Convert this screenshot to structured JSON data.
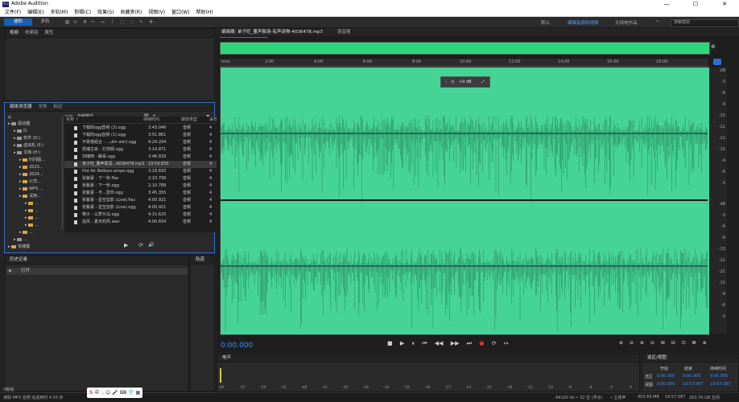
{
  "window": {
    "app_title": "Adobe Audition",
    "logo_text": "Au",
    "minimize": "—",
    "maximize": "☐",
    "close": "✕"
  },
  "menu": [
    "文件(F)",
    "编辑(E)",
    "多轨(M)",
    "剪辑(C)",
    "效果(S)",
    "收藏夹(R)",
    "视图(V)",
    "窗口(W)",
    "帮助(H)"
  ],
  "toolbar": {
    "waveform_label": "波形",
    "multitrack_label": "多轨",
    "workspace_default": "默认",
    "workspace_active": "编辑音频到视频",
    "workspace_radio": "无线电作品",
    "search_placeholder": "搜索帮助"
  },
  "files_panel": {
    "tabs": [
      "视频",
      "效果组",
      "属性"
    ]
  },
  "media_browser": {
    "tabs": [
      "媒体浏览器",
      "文件",
      "标记"
    ],
    "content_label": "内容:",
    "content_value": "音频模式",
    "tree": [
      {
        "label": "驱动器",
        "kind": "drive",
        "indent": 0
      },
      {
        "label": "D:",
        "kind": "drive",
        "indent": 1
      },
      {
        "label": "软件 (D:)",
        "kind": "drive",
        "indent": 1
      },
      {
        "label": "虚拟机 (E:)",
        "kind": "drive",
        "indent": 1
      },
      {
        "label": "文档 (H:)",
        "kind": "drive",
        "indent": 1
      },
      {
        "label": "时间图...",
        "kind": "folder",
        "indent": 2
      },
      {
        "label": "2023...",
        "kind": "folder",
        "indent": 2
      },
      {
        "label": "2024...",
        "kind": "folder",
        "indent": 2
      },
      {
        "label": "公司...",
        "kind": "folder",
        "indent": 2
      },
      {
        "label": "WPS ...",
        "kind": "folder",
        "indent": 2
      },
      {
        "label": "试用...",
        "kind": "folder",
        "indent": 2
      },
      {
        "label": "...",
        "kind": "folder",
        "indent": 3
      },
      {
        "label": "...",
        "kind": "folder",
        "indent": 3
      },
      {
        "label": "...",
        "kind": "folder",
        "indent": 3
      },
      {
        "label": "...",
        "kind": "folder",
        "indent": 3
      },
      {
        "label": "...",
        "kind": "folder",
        "indent": 2
      },
      {
        "label": "...",
        "kind": "drive",
        "indent": 1
      },
      {
        "label": "快捷键",
        "kind": "folder",
        "indent": 0
      }
    ],
    "columns": {
      "name": "名称 ↑",
      "duration": "持续时间",
      "type": "媒体类型",
      "rate": "采样"
    },
    "files": [
      {
        "name": "下载的ogg音频 (2).ogg",
        "duration": "3:43.046",
        "type": "音频",
        "rate": "4"
      },
      {
        "name": "下载的ogg音频 (1).ogg",
        "duration": "3:51.861",
        "type": "音频",
        "rate": "4"
      },
      {
        "name": "不靠谱组合 - ...ulin wiri).ogg",
        "duration": "4:24.204",
        "type": "音频",
        "rate": "4"
      },
      {
        "name": "凯瑞主目 - 打捞钥.ogg",
        "duration": "3:14.871",
        "type": "音频",
        "rate": "4"
      },
      {
        "name": "刘瑞琦 - 躺哥.ogg",
        "duration": "3:46.816",
        "type": "音频",
        "rate": "4"
      },
      {
        "name": "弟子旺_董声振清...4036478.mp3",
        "duration": "19:59.830",
        "type": "音频",
        "rate": "4"
      },
      {
        "name": "Hot Air Balloon-ampe.ogg",
        "duration": "3:18.693",
        "type": "音频",
        "rate": "4"
      },
      {
        "name": "张紫豪 - 下一秒.flac",
        "duration": "2:10.799",
        "type": "音频",
        "rate": "4"
      },
      {
        "name": "张紫豪 - 下一秒.ogg",
        "duration": "2:10.789",
        "type": "音频",
        "rate": "4"
      },
      {
        "name": "张紫豪 - 不...爱你.ogg",
        "duration": "3:45.355",
        "type": "音频",
        "rate": "4"
      },
      {
        "name": "张紫豪 - 星空剪影 (Live).flac",
        "duration": "4:00.921",
        "type": "音频",
        "rate": "4"
      },
      {
        "name": "张紫豪 - 星空剪影 (Live).ogg",
        "duration": "4:00.921",
        "type": "音频",
        "rate": "4"
      },
      {
        "name": "筷子 - 以梦为马.ogg",
        "duration": "4:15.625",
        "type": "音频",
        "rate": "4"
      },
      {
        "name": "遥风 - 夏天的风.wav",
        "duration": "4:00.654",
        "type": "音频",
        "rate": "4"
      }
    ],
    "selected_index": 5,
    "play_icons": [
      "▶",
      "⟳",
      "🔊"
    ]
  },
  "history": {
    "tabs": [
      "历史记录"
    ],
    "item": "打开"
  },
  "side_tab": "轨道",
  "editor": {
    "tabs": [
      "编辑器: 弟子旺_董声振清-有声读物-4036478.mp3",
      "混音器"
    ],
    "ruler_unit": "hms",
    "ruler_ticks": [
      "2:00",
      "4:00",
      "6:00",
      "8:00",
      "10:00",
      "12:00",
      "14:00",
      "16:00",
      "18:00"
    ],
    "hud_text": "+0 dB",
    "db_labels_top": [
      "dB",
      "-3",
      "-6",
      "-9",
      "-15",
      "-21",
      "-21",
      "-15",
      "-9",
      "-6",
      "-3"
    ],
    "db_labels_bottom": [
      "dB",
      "-3",
      "-6",
      "-9",
      "-15",
      "-21",
      "-21",
      "-15",
      "-9",
      "-6",
      "-3"
    ],
    "timecode": "0:00.000",
    "waveform_color": "#46d496",
    "waveform_dark": "#0f3d26",
    "transport": [
      "■",
      "▶",
      "⏸",
      "⏮",
      "◀◀",
      "▶▶",
      "⏭",
      "●",
      "⟳",
      "↦"
    ],
    "zoom_icons": [
      "⊕",
      "⊖",
      "⊕",
      "⊖",
      "⊞",
      "⊟",
      "⊡",
      "⊠",
      "⊕"
    ]
  },
  "levels": {
    "title": "电平",
    "ticks": [
      "dB",
      "-57",
      "-54",
      "-51",
      "-48",
      "-45",
      "-42",
      "-39",
      "-36",
      "-33",
      "-30",
      "-27",
      "-24",
      "-21",
      "-18",
      "-15",
      "-12",
      "-9",
      "-6",
      "-3",
      "0"
    ]
  },
  "selection_view": {
    "title": "选区/视图",
    "headers": [
      "开始",
      "结束",
      "持续时间"
    ],
    "rows": [
      {
        "label": "选区",
        "start": "0:00.000",
        "end": "0:00.000",
        "duration": "0:00.000"
      },
      {
        "label": "视图",
        "start": "0:00.000",
        "end": "19:57.087",
        "duration": "19:57.087"
      }
    ]
  },
  "status": {
    "left": "读取 MP3 音频 完成用时 4.55 秒",
    "right_rate": "44100 Hz • 32 位 (浮点)",
    "right_channel": "• 立体声",
    "right_size": "403.69 MB",
    "right_dur": "19:57.087",
    "right_free": "263.76 GB 空闲",
    "undo": "0撤销"
  },
  "ime": {
    "brand": "S",
    "text": "中"
  }
}
